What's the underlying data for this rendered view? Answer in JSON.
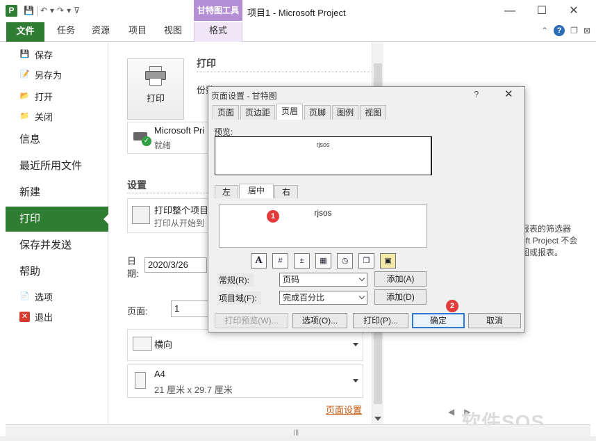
{
  "titlebar": {
    "app_logo": "P",
    "qat_icons": [
      "save-icon",
      "undo-icon",
      "redo-icon"
    ],
    "context_tab": "甘特图工具",
    "window_title": "项目1 - Microsoft Project",
    "controls": {
      "minimize": "—",
      "maximize": "☐",
      "close": "✕"
    }
  },
  "ribbon": {
    "file_tab": "文件",
    "tabs": [
      "任务",
      "资源",
      "项目",
      "视图",
      "格式"
    ]
  },
  "nav": {
    "save": "保存",
    "save_as": "另存为",
    "open": "打开",
    "close": "关闭",
    "info": "信息",
    "recent": "最近所用文件",
    "new": "新建",
    "print": "打印",
    "save_send": "保存并发送",
    "help": "帮助",
    "options": "选项",
    "exit": "退出"
  },
  "print_pane": {
    "print_button": "打印",
    "print_heading": "打印",
    "copies_label": "份数",
    "printer_name": "Microsoft Pri",
    "printer_status": "就绪",
    "settings_heading": "设置",
    "print_scope_title": "打印整个项目",
    "print_scope_sub": "打印从开始到",
    "date_label": "日期:",
    "date_value": "2020/3/26",
    "page_label": "页面:",
    "page_value": "1",
    "orientation": "横向",
    "paper_name": "A4",
    "paper_size": "21 厘米 x 29.7 厘米",
    "page_setup_link": "页面设置"
  },
  "preview_pane": {
    "message_lines": [
      "报表的筛选器",
      "oft Project 不会",
      "图或报表。"
    ],
    "watermark": "软件SOS"
  },
  "dialog": {
    "title": "页面设置 - 甘特图",
    "help": "?",
    "close": "✕",
    "tabs": [
      "页面",
      "页边距",
      "页眉",
      "页脚",
      "图例",
      "视图"
    ],
    "active_tab": "页眉",
    "preview_label": "预览:",
    "preview_text": "rjsos",
    "align_tabs": [
      "左",
      "居中",
      "右"
    ],
    "active_align_tab": "居中",
    "edit_text": "rjsos",
    "toolbar_icons": [
      "font-icon",
      "page-number-icon",
      "total-pages-icon",
      "date-icon",
      "time-icon",
      "file-name-icon",
      "picture-icon"
    ],
    "general_label": "常规(R):",
    "general_value": "页码",
    "field_label": "项目域(F):",
    "field_value": "完成百分比",
    "add_a": "添加(A)",
    "add_d": "添加(D)",
    "print_preview": "打印预览(W)...",
    "options": "选项(O)...",
    "print": "打印(P)...",
    "ok": "确定",
    "cancel": "取消",
    "badge1": "1",
    "badge2": "2"
  },
  "colors": {
    "accent_green": "#2f7d32",
    "context_purple": "#b58fd6",
    "link_orange": "#c5550b",
    "badge_red": "#e23b3b",
    "primary_blue": "#2b79d6"
  }
}
